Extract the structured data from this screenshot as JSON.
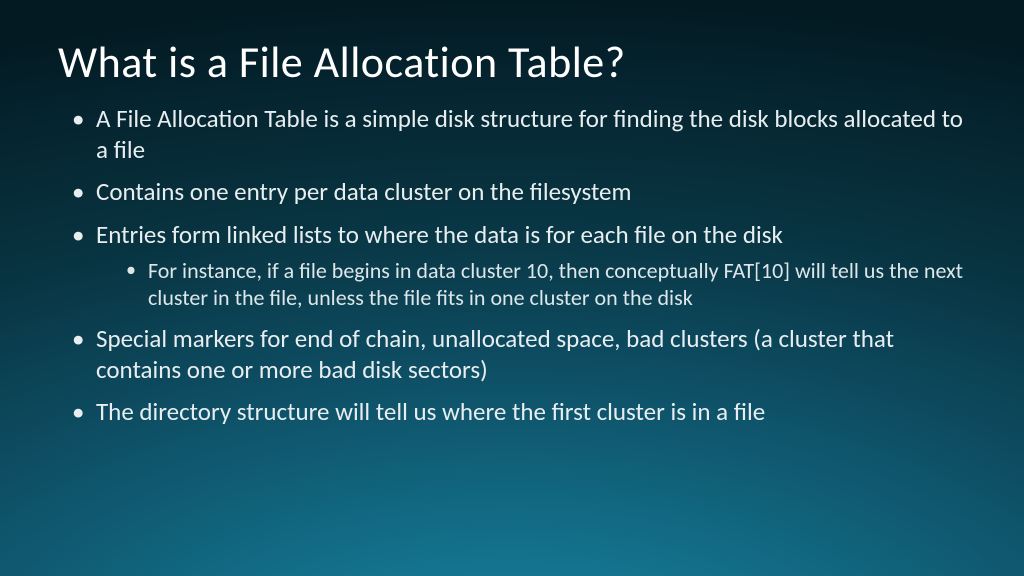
{
  "title": "What is a File Allocation Table?",
  "bullets": [
    {
      "text": "A File Allocation Table is a simple disk structure for finding the disk blocks allocated to a file"
    },
    {
      "text": "Contains one entry per data cluster on the filesystem"
    },
    {
      "text": "Entries form linked lists to where the data is for each file on the disk",
      "sub": [
        "For instance, if a file begins in data cluster 10, then conceptually FAT[10] will tell us the next cluster in the file, unless the file fits in one cluster on the disk"
      ]
    },
    {
      "text": "Special markers for end of chain, unallocated space, bad clusters (a cluster that contains one or more bad disk sectors)"
    },
    {
      "text": "The directory structure will tell us where the first cluster is in a file"
    }
  ]
}
